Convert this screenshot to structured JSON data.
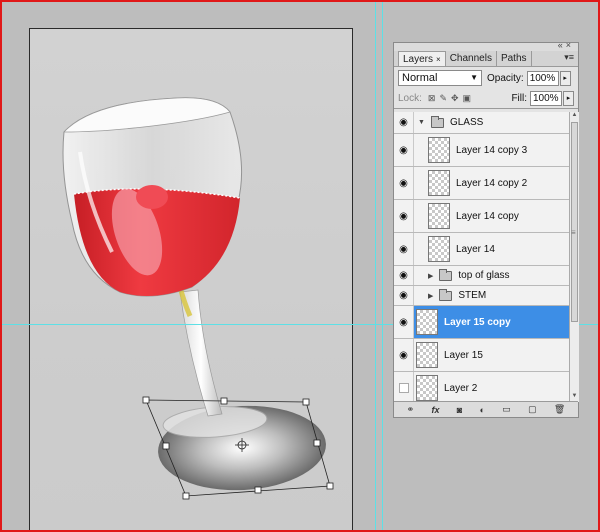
{
  "panel": {
    "tabs": [
      "Layers",
      "Channels",
      "Paths"
    ],
    "tab_close": "×",
    "blend_mode": "Normal",
    "opacity_label": "Opacity:",
    "opacity_value": "100%",
    "lock_label": "Lock:",
    "fill_label": "Fill:",
    "fill_value": "100%"
  },
  "layers": [
    {
      "name": "GLASS",
      "kind": "group",
      "visible": true,
      "expanded": true
    },
    {
      "name": "Layer 14 copy 3",
      "kind": "layer",
      "visible": true,
      "indented": true
    },
    {
      "name": "Layer 14 copy 2",
      "kind": "layer",
      "visible": true,
      "indented": true
    },
    {
      "name": "Layer 14 copy",
      "kind": "layer",
      "visible": true,
      "indented": true
    },
    {
      "name": "Layer 14",
      "kind": "layer",
      "visible": true,
      "indented": true
    },
    {
      "name": "top of glass",
      "kind": "subgroup",
      "visible": true
    },
    {
      "name": "STEM",
      "kind": "subgroup",
      "visible": true
    },
    {
      "name": "Layer 15 copy",
      "kind": "layer",
      "visible": true,
      "selected": true
    },
    {
      "name": "Layer 15",
      "kind": "layer",
      "visible": true
    },
    {
      "name": "Layer 2",
      "kind": "layer",
      "visible": false
    }
  ],
  "icons": {
    "eye": "eye-icon",
    "link": "link-layers-icon",
    "fx": "fx",
    "mask": "add-mask-icon",
    "adjust": "adjustment-layer-icon",
    "group": "new-group-icon",
    "new": "new-layer-icon",
    "delete": "trash-icon"
  },
  "colors": {
    "selection": "#3d8ee6",
    "wine": "#e2262f",
    "guide": "#5de0e6",
    "frame": "#e01818"
  }
}
